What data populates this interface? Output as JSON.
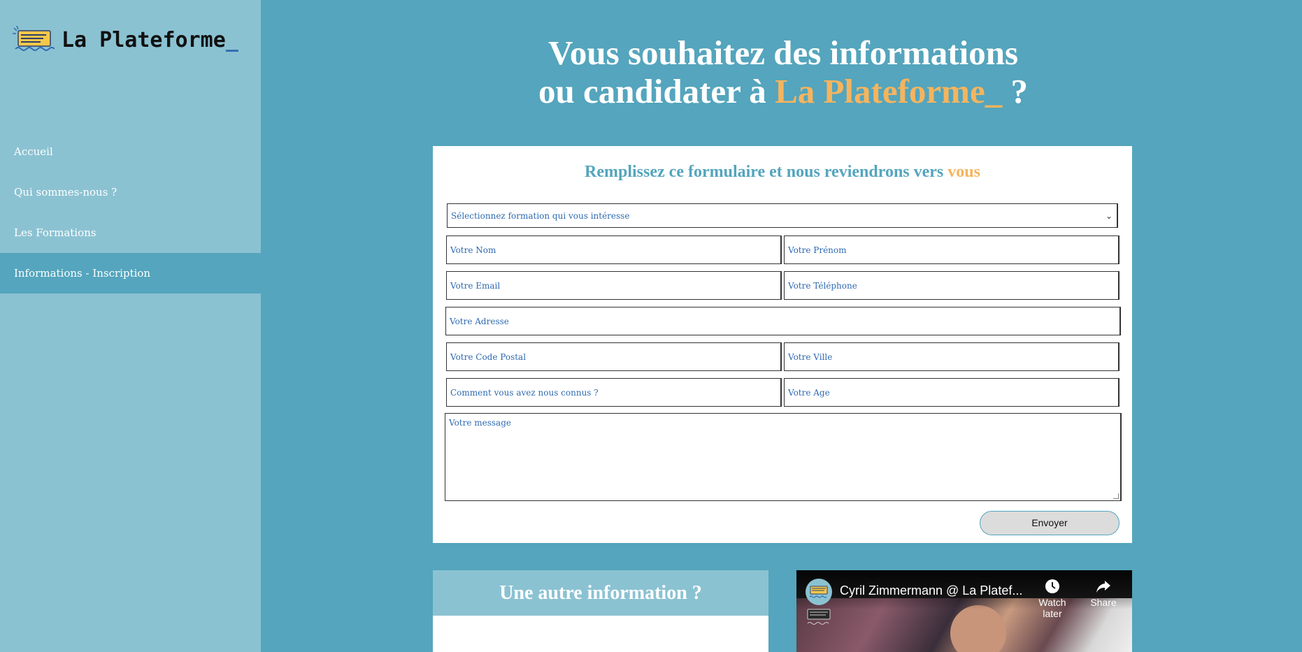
{
  "sidebar": {
    "logo_text": "La Plateforme",
    "logo_cursor": "_",
    "nav": [
      {
        "label": "Accueil"
      },
      {
        "label": "Qui sommes-nous ?"
      },
      {
        "label": "Les Formations"
      },
      {
        "label": "Informations - Inscription",
        "active": true
      }
    ]
  },
  "headline": {
    "line1": "Vous souhaitez des informations",
    "line2_prefix": "ou candidater à ",
    "line2_accent": "La Plateforme_",
    "line2_suffix": " ?"
  },
  "form": {
    "title_prefix": "Remplissez ce formulaire et nous reviendrons vers ",
    "title_accent": "vous",
    "select_placeholder": "Sélectionnez formation qui vous intéresse",
    "placeholders": {
      "nom": "Votre Nom",
      "prenom": "Votre Prénom",
      "email": "Votre Email",
      "telephone": "Votre Téléphone",
      "adresse": "Votre Adresse",
      "code_postal": "Votre Code Postal",
      "ville": "Votre Ville",
      "source": "Comment vous avez nous connus ?",
      "age": "Votre Age",
      "message": "Votre message"
    },
    "submit_label": "Envoyer"
  },
  "info_section": {
    "title": "Une autre information ?"
  },
  "video": {
    "title": "Cyril Zimmermann @ La Platef...",
    "watch_later_label": "Watch later",
    "share_label": "Share"
  },
  "colors": {
    "page_bg": "#54a5bd",
    "sidebar_bg": "#8bc2d2",
    "accent": "#f5b45e",
    "text_blue": "#2f6ab1"
  }
}
